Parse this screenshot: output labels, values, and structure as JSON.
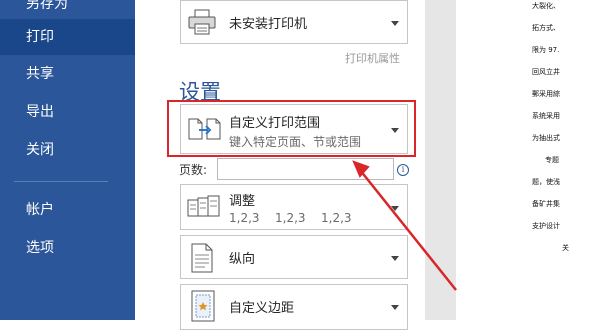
{
  "nav": {
    "items": [
      {
        "label": "另存为",
        "name": "nav-item-save-as",
        "state": "partially-visible"
      },
      {
        "label": "打印",
        "name": "nav-item-print",
        "state": "active"
      },
      {
        "label": "共享",
        "name": "nav-item-share"
      },
      {
        "label": "导出",
        "name": "nav-item-export"
      },
      {
        "label": "关闭",
        "name": "nav-item-close"
      },
      {
        "label": "帐户",
        "name": "nav-item-account"
      },
      {
        "label": "选项",
        "name": "nav-item-options"
      }
    ]
  },
  "printer": {
    "name": "未安装打印机",
    "properties_link": "打印机属性",
    "icon": "printer-icon"
  },
  "settings": {
    "heading": "设置",
    "print_range": {
      "title": "自定义打印范围",
      "subtitle": "键入特定页面、节或范围",
      "icon": "custom-range-icon"
    },
    "pages": {
      "label": "页数:",
      "value": "",
      "info_icon": "i"
    },
    "collate": {
      "title": "调整",
      "sequence": [
        "1,2,3",
        "1,2,3",
        "1,2,3"
      ],
      "icon": "collate-icon"
    },
    "orientation": {
      "title": "纵向",
      "icon": "portrait-page-icon"
    },
    "margins": {
      "title": "自定义边距",
      "icon": "margins-icon"
    }
  },
  "preview": {
    "lines": [
      "大裂化、",
      "拓方式、",
      "限为 97.",
      "回风立井",
      "郵采用綜",
      "系统采用",
      "为抽出式",
      "专题",
      "题，使浅",
      "备矿井集",
      "支护设计",
      "关"
    ]
  },
  "colors": {
    "nav_bg": "#2b579a",
    "nav_active": "#19478a",
    "accent": "#2b579a",
    "highlight_border": "#d9262b",
    "preview_bg": "#e6e6e6"
  }
}
